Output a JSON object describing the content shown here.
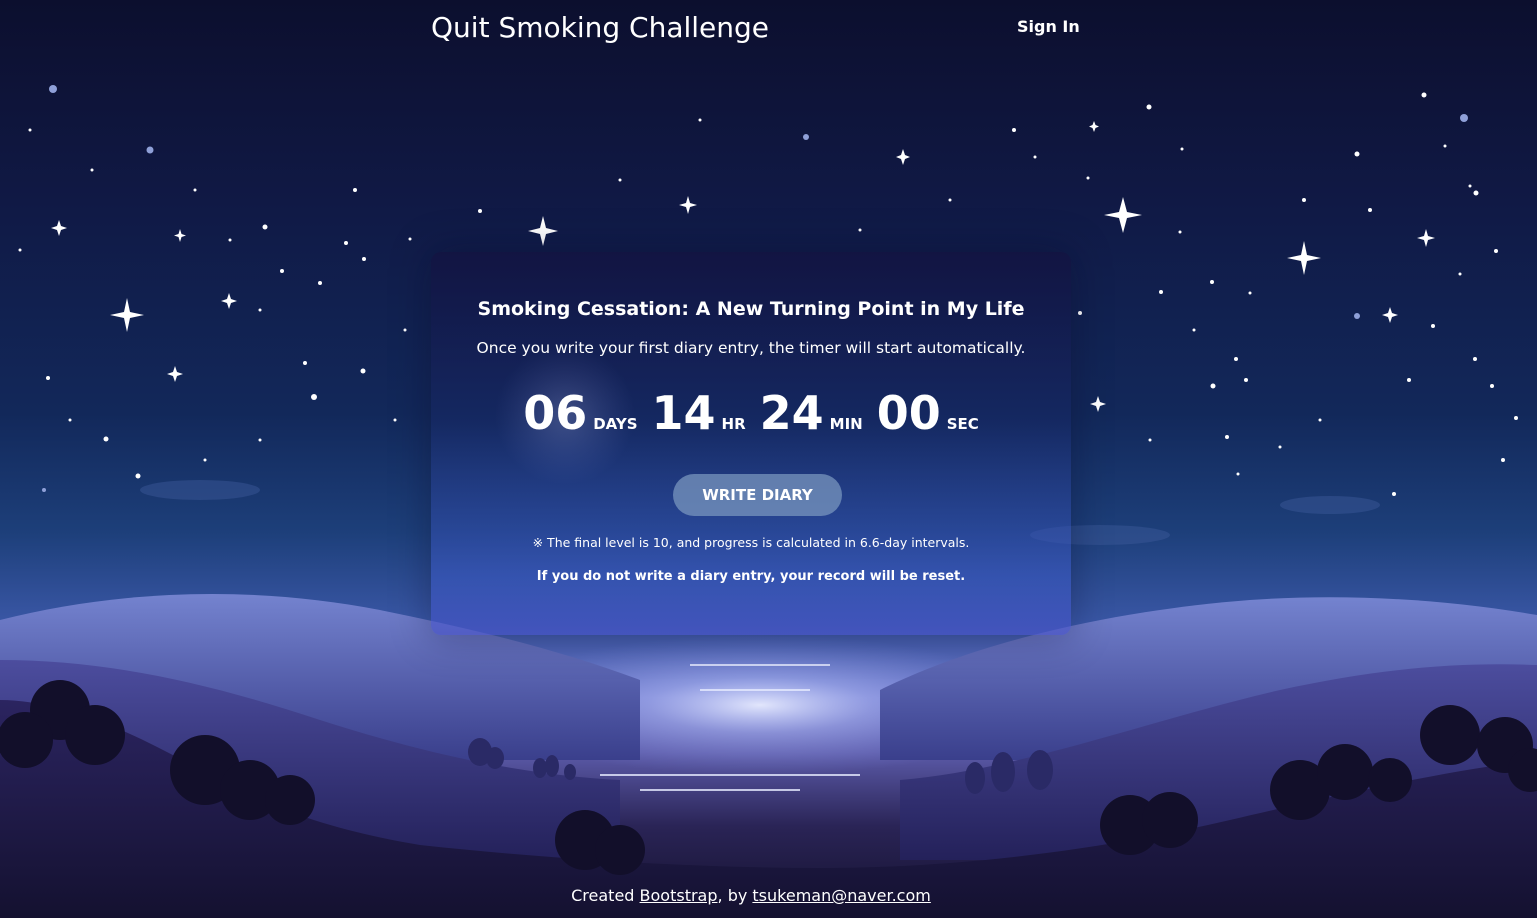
{
  "navbar": {
    "brand": "Quit Smoking Challenge",
    "sign_in": "Sign In"
  },
  "card": {
    "title": "Smoking Cessation: A New Turning Point in My Life",
    "subtitle": "Once you write your first diary entry, the timer will start automatically.",
    "timer": {
      "days": "06",
      "days_unit": "DAYS",
      "hours": "14",
      "hours_unit": "HR",
      "minutes": "24",
      "minutes_unit": "MIN",
      "seconds": "00",
      "seconds_unit": "SEC"
    },
    "write_button": "WRITE DIARY",
    "note_level": "※ The final level is 10, and progress is calculated in 6.6-day intervals.",
    "note_reset": "If you do not write a diary entry, your record will be reset."
  },
  "footer": {
    "created": "Created ",
    "link_bootstrap": "Bootstrap",
    "by": ", by ",
    "link_email": "tsukeman@naver.com"
  },
  "colors": {
    "sky_top": "#0c0f2e",
    "sky_mid": "#12285a",
    "horizon": "#6f78c9",
    "hills_dark": "#14112e",
    "button_bg": "#7896be"
  }
}
